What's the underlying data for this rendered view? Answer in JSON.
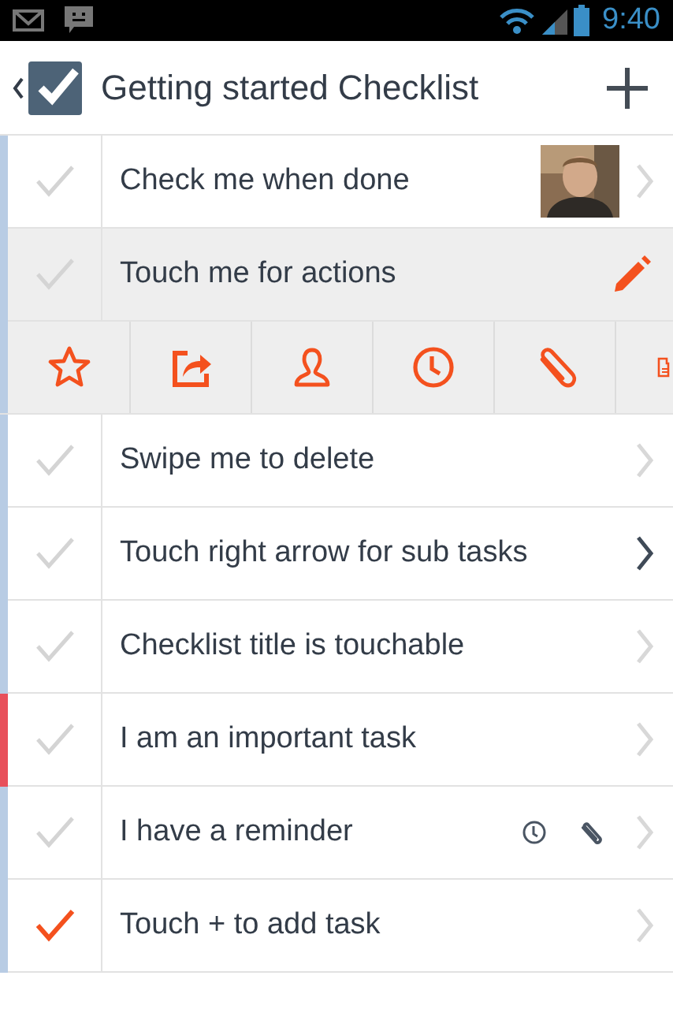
{
  "status_bar": {
    "time": "9:40"
  },
  "header": {
    "title": "Getting started Checklist"
  },
  "tasks": [
    {
      "title": "Check me when done",
      "checked": false,
      "selected": false,
      "color": "#b8cce4",
      "kind": "chevron",
      "photo": true,
      "reminder": false,
      "attachment": false
    },
    {
      "title": "Touch me for actions",
      "checked": false,
      "selected": true,
      "color": "#b8cce4",
      "kind": "pencil",
      "photo": false,
      "reminder": false,
      "attachment": false
    },
    {
      "title": "Swipe me to delete",
      "checked": false,
      "selected": false,
      "color": "#b8cce4",
      "kind": "chevron",
      "photo": false,
      "reminder": false,
      "attachment": false
    },
    {
      "title": "Touch right arrow for sub tasks",
      "checked": false,
      "selected": false,
      "color": "#b8cce4",
      "kind": "chevron-dark",
      "photo": false,
      "reminder": false,
      "attachment": false
    },
    {
      "title": "Checklist title is touchable",
      "checked": false,
      "selected": false,
      "color": "#b8cce4",
      "kind": "chevron",
      "photo": false,
      "reminder": false,
      "attachment": false
    },
    {
      "title": "I am an important task",
      "checked": false,
      "selected": false,
      "color": "#e8505b",
      "kind": "chevron",
      "photo": false,
      "reminder": false,
      "attachment": false
    },
    {
      "title": "I have a reminder",
      "checked": false,
      "selected": false,
      "color": "#b8cce4",
      "kind": "chevron",
      "photo": false,
      "reminder": true,
      "attachment": true
    },
    {
      "title": "Touch + to add task",
      "checked": true,
      "selected": false,
      "color": "#b8cce4",
      "kind": "chevron",
      "photo": false,
      "reminder": false,
      "attachment": false
    }
  ],
  "actions": [
    {
      "kind": "star"
    },
    {
      "kind": "share"
    },
    {
      "kind": "person"
    },
    {
      "kind": "clock"
    },
    {
      "kind": "clip"
    },
    {
      "kind": "note"
    }
  ]
}
